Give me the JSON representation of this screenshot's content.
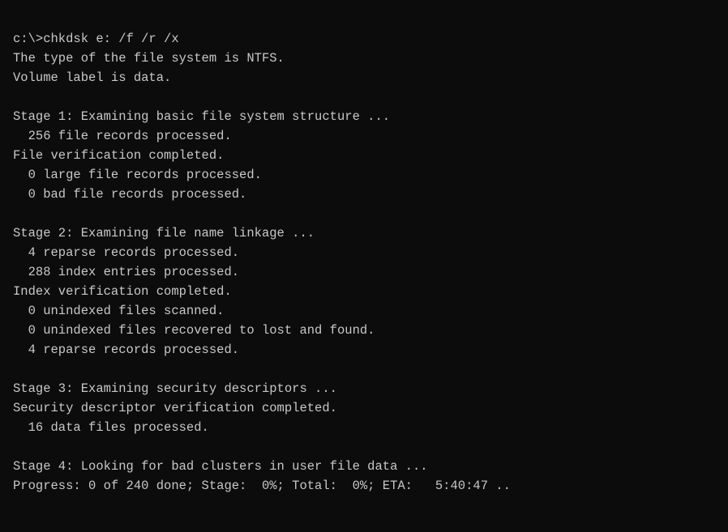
{
  "terminal": {
    "lines": [
      {
        "id": "cmd-line",
        "text": "c:\\>chkdsk e: /f /r /x"
      },
      {
        "id": "line-1",
        "text": "The type of the file system is NTFS."
      },
      {
        "id": "line-2",
        "text": "Volume label is data."
      },
      {
        "id": "empty-1",
        "text": ""
      },
      {
        "id": "line-3",
        "text": "Stage 1: Examining basic file system structure ..."
      },
      {
        "id": "line-4",
        "text": "  256 file records processed."
      },
      {
        "id": "line-5",
        "text": "File verification completed."
      },
      {
        "id": "line-6",
        "text": "  0 large file records processed."
      },
      {
        "id": "line-7",
        "text": "  0 bad file records processed."
      },
      {
        "id": "empty-2",
        "text": ""
      },
      {
        "id": "line-8",
        "text": "Stage 2: Examining file name linkage ..."
      },
      {
        "id": "line-9",
        "text": "  4 reparse records processed."
      },
      {
        "id": "line-10",
        "text": "  288 index entries processed."
      },
      {
        "id": "line-11",
        "text": "Index verification completed."
      },
      {
        "id": "line-12",
        "text": "  0 unindexed files scanned."
      },
      {
        "id": "line-13",
        "text": "  0 unindexed files recovered to lost and found."
      },
      {
        "id": "line-14",
        "text": "  4 reparse records processed."
      },
      {
        "id": "empty-3",
        "text": ""
      },
      {
        "id": "line-15",
        "text": "Stage 3: Examining security descriptors ..."
      },
      {
        "id": "line-16",
        "text": "Security descriptor verification completed."
      },
      {
        "id": "line-17",
        "text": "  16 data files processed."
      },
      {
        "id": "empty-4",
        "text": ""
      },
      {
        "id": "line-18",
        "text": "Stage 4: Looking for bad clusters in user file data ..."
      },
      {
        "id": "line-19",
        "text": "Progress: 0 of 240 done; Stage:  0%; Total:  0%; ETA:   5:40:47 .."
      }
    ]
  }
}
